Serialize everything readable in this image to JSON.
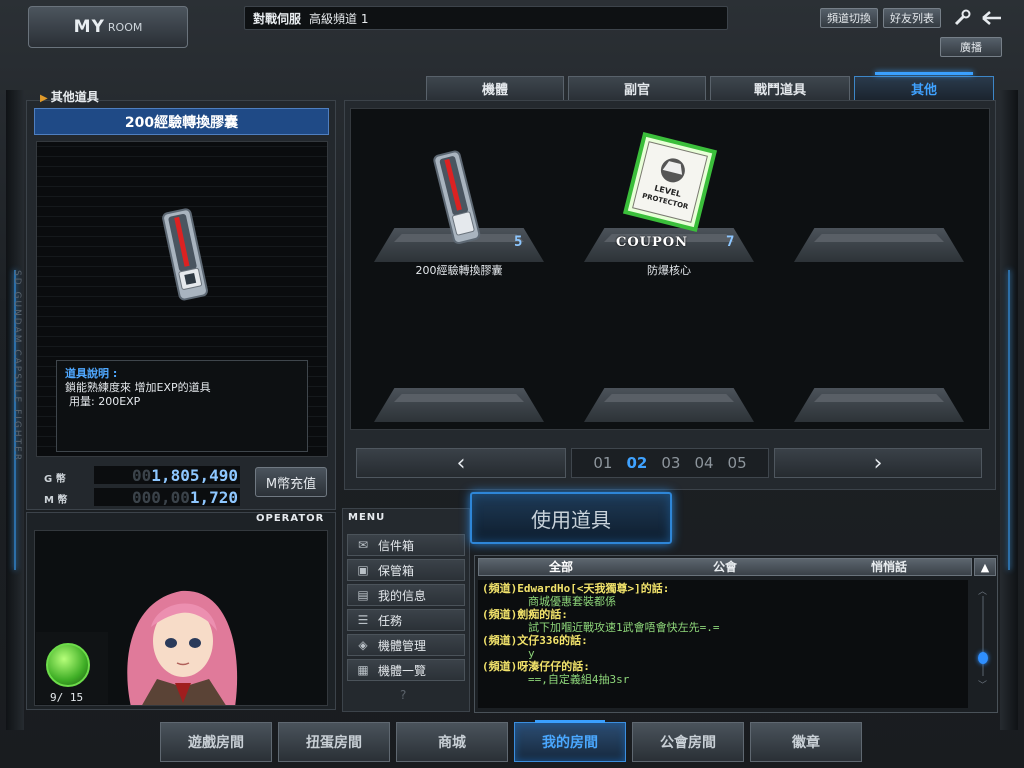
{
  "header": {
    "logo_main": "MY",
    "logo_sub": "ROOM",
    "server": "對戰伺服",
    "channel": "高級頻道 1",
    "channel_switch": "頻道切換",
    "friends_list": "好友列表",
    "broadcast": "廣播",
    "side_text": "SD GUNDAM CAPSULE FIGHTER"
  },
  "left_panel": {
    "section_title": "其他道具",
    "item_name": "200經驗轉換膠囊",
    "desc_title": "道具說明 :",
    "desc_line1": "鎖能熟練度來 增加EXP的道具",
    "desc_line2": "用量: 200EXP"
  },
  "currency": {
    "g_label": "G 幣",
    "g_dim": "00",
    "g_value": "1,805,490",
    "m_label": "M 幣",
    "m_dim": "000,00",
    "m_value": "1,720",
    "recharge": "M幣充值"
  },
  "operator": {
    "label": "OPERATOR",
    "level": "9/ 15"
  },
  "menu": {
    "label": "MENU",
    "items": [
      "信件箱",
      "保管箱",
      "我的信息",
      "任務",
      "機體管理",
      "機體一覽"
    ],
    "help": "?"
  },
  "tabs": [
    "機體",
    "副官",
    "戰鬥道具",
    "其他"
  ],
  "inventory": {
    "slots": [
      {
        "name": "200經驗轉換膠囊",
        "qty": "5"
      },
      {
        "name": "防爆核心",
        "qty": "7",
        "badge": "COUPON",
        "card_text": "LEVEL PROTECTOR"
      },
      {
        "name": "",
        "qty": ""
      },
      {
        "name": "",
        "qty": ""
      },
      {
        "name": "",
        "qty": ""
      },
      {
        "name": "",
        "qty": ""
      }
    ],
    "prev": "‹",
    "next": "›",
    "pages": [
      "01",
      "02",
      "03",
      "04",
      "05"
    ],
    "current_page": "02"
  },
  "use_button": "使用道具",
  "chat": {
    "tabs": [
      "全部",
      "公會",
      "悄悄話"
    ],
    "lines": [
      {
        "speaker": "(頻道)EdwardHo[<天我獨尊>]的話:",
        "msg": "商城優惠套裝都係"
      },
      {
        "speaker": "(頻道)劍痴的話:",
        "msg": "試下加嗰近戰攻速1武會唔會快左先=.="
      },
      {
        "speaker": "(頻道)文仔336的話:",
        "msg": "y"
      },
      {
        "speaker": "(頻道)呀湊仔仔的話:",
        "msg": "==,自定義組4抽3sr"
      }
    ]
  },
  "bottom_nav": [
    "遊戲房間",
    "扭蛋房間",
    "商城",
    "我的房間",
    "公會房間",
    "徽章"
  ],
  "bottom_nav_active": "我的房間",
  "colors": {
    "accent": "#3fa2ff",
    "coupon_green": "#6ddc4a",
    "chat_speaker": "#f2e36b",
    "chat_msg": "#8ed67a"
  }
}
